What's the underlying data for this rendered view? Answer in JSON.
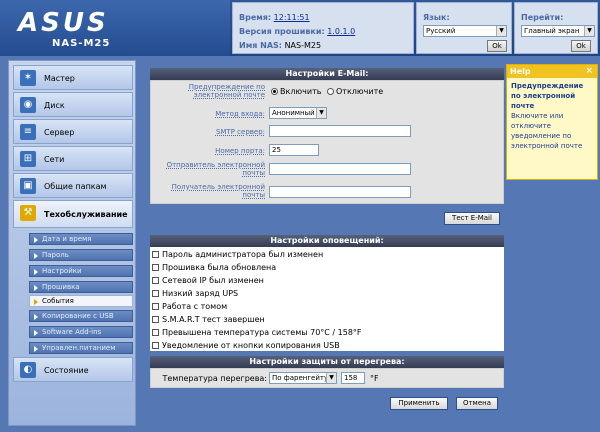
{
  "brand": {
    "logo": "ASUS",
    "model": "NAS-M25"
  },
  "status": {
    "time_label": "Время:",
    "time_value": "12:11:51",
    "firmware_label": "Версия прошивки:",
    "firmware_value": "1.0.1.0",
    "nas_label": "Имя NAS:",
    "nas_value": "NAS-M25"
  },
  "language": {
    "label": "Язык:",
    "selected": "Русский",
    "ok": "Ok"
  },
  "goto": {
    "label": "Перейти:",
    "selected": "Главный экран",
    "ok": "Ok"
  },
  "sidebar": {
    "items": [
      {
        "label": "Мастер",
        "icon": "wand-icon"
      },
      {
        "label": "Диск",
        "icon": "disk-icon"
      },
      {
        "label": "Сервер",
        "icon": "server-icon"
      },
      {
        "label": "Сети",
        "icon": "network-icon"
      },
      {
        "label": "Общие папкам",
        "icon": "shared-folder-icon"
      },
      {
        "label": "Техобслуживание",
        "icon": "tools-icon"
      },
      {
        "label": "Состояние",
        "icon": "status-icon"
      }
    ],
    "subitems": [
      "Дата и время",
      "Пароль",
      "Настройки",
      "Прошивка",
      "События",
      "Копирование с USB",
      "Software Add-ins",
      "Управлен.питанием"
    ]
  },
  "email": {
    "title": "Настройки E-Mail:",
    "warning_label": "Предупреждение по электронной почте",
    "enable": "Включить",
    "disable": "Отключите",
    "login_label": "Метод входа:",
    "login_value": "Анонимный",
    "smtp_label": "SMTP сервер:",
    "smtp_value": "",
    "port_label": "Номер порта:",
    "port_value": "25",
    "sender_label": "Отправитель электронной почты",
    "sender_value": "",
    "recipient_label": "Получатель электронной почты",
    "recipient_value": "",
    "test_button": "Тест E-Mail"
  },
  "notify": {
    "title": "Настройки оповещений:",
    "items": [
      "Пароль администратора был изменен",
      "Прошивка была обновлена",
      "Сетевой IP был изменен",
      "Низкий заряд UPS",
      "Работа с томом",
      "S.M.A.R.T тест завершен",
      "Превышена температура системы 70°C / 158°F",
      "Уведомление от кнопки копирования USB"
    ]
  },
  "overheat": {
    "title": "Настройки защиты от перегрева:",
    "temp_label": "Температура перегрева:",
    "unit_select": "По фаренгейту",
    "temp_value": "158",
    "unit": "°F"
  },
  "actions": {
    "apply": "Применить",
    "cancel": "Отмена"
  },
  "help": {
    "header": "Help",
    "close": "×",
    "title": "Предупреждение по электронной почте",
    "body": "Включите или отключите уведомление по электронной почте"
  },
  "colors": {
    "header": "#1d4385",
    "panel_title": "#343c52",
    "help_bg": "#fff9c8",
    "accent": "#4a6aa8"
  }
}
